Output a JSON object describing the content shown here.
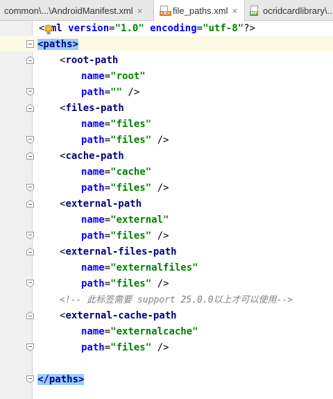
{
  "tabs": [
    {
      "label": "common\\...\\AndroidManifest.xml",
      "close": "×",
      "active": false
    },
    {
      "label": "file_paths.xml",
      "close": "×",
      "active": true,
      "icon": "xml-file-icon",
      "icon_text": "<X>"
    },
    {
      "label": "ocridcardlibrary\\...",
      "active": false,
      "icon": "manifest-file-icon",
      "icon_text": "MF"
    }
  ],
  "code": {
    "l1": {
      "lt": "<",
      "decl": "xml",
      "a1": " version",
      "eq1": "=",
      "v1": "\"1.0\"",
      "a2": " encoding",
      "eq2": "=",
      "v2": "\"utf-8\"",
      "end": "?>"
    },
    "l2": {
      "open": "<paths>"
    },
    "l3": {
      "lt": "<",
      "tag": "root-path"
    },
    "l4": {
      "attr": "name",
      "eq": "=",
      "val": "\"root\""
    },
    "l5": {
      "attr": "path",
      "eq": "=",
      "val": "\"\"",
      "end": " />"
    },
    "l6": {
      "lt": "<",
      "tag": "files-path"
    },
    "l7": {
      "attr": "name",
      "eq": "=",
      "val": "\"files\""
    },
    "l8": {
      "attr": "path",
      "eq": "=",
      "val": "\"files\"",
      "end": " />"
    },
    "l9": {
      "lt": "<",
      "tag": "cache-path"
    },
    "l10": {
      "attr": "name",
      "eq": "=",
      "val": "\"cache\""
    },
    "l11": {
      "attr": "path",
      "eq": "=",
      "val": "\"files\"",
      "end": " />"
    },
    "l12": {
      "lt": "<",
      "tag": "external-path"
    },
    "l13": {
      "attr": "name",
      "eq": "=",
      "val": "\"external\""
    },
    "l14": {
      "attr": "path",
      "eq": "=",
      "val": "\"files\"",
      "end": " />"
    },
    "l15": {
      "lt": "<",
      "tag": "external-files-path"
    },
    "l16": {
      "attr": "name",
      "eq": "=",
      "val": "\"externalfiles\""
    },
    "l17": {
      "attr": "path",
      "eq": "=",
      "val": "\"files\"",
      "end": " />"
    },
    "l18": {
      "comment": "<!-- 此标签需要 support 25.0.0以上才可以使用-->"
    },
    "l19": {
      "lt": "<",
      "tag": "external-cache-path"
    },
    "l20": {
      "attr": "name",
      "eq": "=",
      "val": "\"externalcache\""
    },
    "l21": {
      "attr": "path",
      "eq": "=",
      "val": "\"files\"",
      "end": " />"
    },
    "l23": {
      "close": "</paths>"
    }
  },
  "colors": {
    "tag": "#000080",
    "attribute": "#0000ff",
    "value": "#008000",
    "comment": "#808080",
    "bracket_match": "#99ccff",
    "caret_line": "#fcfae6"
  }
}
